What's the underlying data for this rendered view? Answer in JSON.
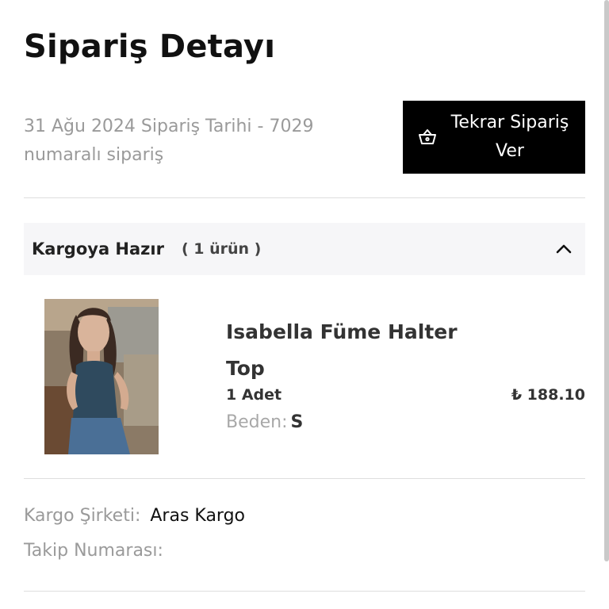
{
  "header": {
    "title": "Sipariş Detayı",
    "order_info": "31 Ağu 2024 Sipariş Tarihi - 7029 numaralı sipariş",
    "reorder_button": {
      "label": "Tekrar Sipariş Ver",
      "icon": "basket-icon"
    }
  },
  "shipment_section": {
    "status": "Kargoya Hazır",
    "item_count": "( 1 ürün )",
    "expanded": true,
    "toggle_icon": "chevron-up-icon"
  },
  "products": [
    {
      "name": "Isabella Füme Halter Top",
      "quantity": "1 Adet",
      "price": "₺ 188.10",
      "size_label": "Beden:",
      "size_value": "S"
    }
  ],
  "shipping": {
    "carrier_label": "Kargo Şirketi:",
    "carrier_value": "Aras Kargo",
    "tracking_label": "Takip Numarası:",
    "tracking_value": ""
  },
  "colors": {
    "button_bg": "#000000",
    "section_bg": "#f6f6f8",
    "muted_text": "#9a9a9a",
    "divider": "#dedede"
  }
}
